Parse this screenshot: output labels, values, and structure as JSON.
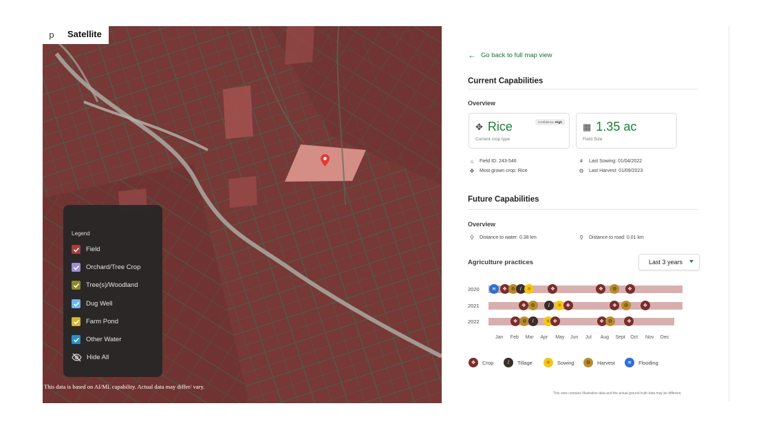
{
  "map": {
    "prev_tab": "p",
    "satellite_tab": "Satellite",
    "disclaimer": "This data is based on AI/ML capability. Actual data may differ/ vary.",
    "legend": {
      "title": "Legend",
      "items": [
        {
          "label": "Field",
          "color": "#b03a3a"
        },
        {
          "label": "Orchard/Tree Crop",
          "color": "#9b8fd6"
        },
        {
          "label": "Tree(s)/Woodland",
          "color": "#8a8a2a"
        },
        {
          "label": "Dug Well",
          "color": "#6fb5f0"
        },
        {
          "label": "Farm Pond",
          "color": "#d4b634"
        },
        {
          "label": "Other Water",
          "color": "#2a8fd0"
        }
      ],
      "hide_all": "Hide All"
    }
  },
  "panel": {
    "back_link": "Go back to full map view",
    "current": {
      "heading": "Current Capabilities",
      "overview": "Overview",
      "crop_value": "Rice",
      "crop_caption": "Current crop type",
      "confidence_label": "Confidence:",
      "confidence_value": "High",
      "size_value": "1.35 ac",
      "size_caption": "Field Size",
      "field_id": "Field ID: 243-546",
      "most_grown": "Most grown crop: Rice",
      "last_sowing": "Last Sowing: 01/04/2022",
      "last_harvest": "Last Harvest: 01/09/2023"
    },
    "future": {
      "heading": "Future Capabilities",
      "overview": "Overview",
      "dist_water": "Distance to water: 0.38 km",
      "dist_road": "Distance to road: 0.01 km"
    },
    "practices": {
      "heading": "Agriculture practices",
      "range_selected": "Last 3 years",
      "months": [
        "Jan",
        "Feb",
        "Mar",
        "Apr",
        "May",
        "Jun",
        "Jul",
        "Aug",
        "Sept",
        "Oct",
        "Nov",
        "Dec"
      ],
      "rows": [
        {
          "year": "2020",
          "events": [
            {
              "type": "flood",
              "month": 0.0
            },
            {
              "type": "crop",
              "month": 0.7
            },
            {
              "type": "harv",
              "month": 1.25
            },
            {
              "type": "till",
              "month": 1.75
            },
            {
              "type": "sow",
              "month": 2.3
            },
            {
              "type": "crop",
              "month": 3.85
            },
            {
              "type": "crop",
              "month": 7.0
            },
            {
              "type": "harv",
              "month": 7.9
            },
            {
              "type": "crop",
              "month": 8.9
            }
          ]
        },
        {
          "year": "2021",
          "events": [
            {
              "type": "crop",
              "month": 1.95
            },
            {
              "type": "harv",
              "month": 2.55
            },
            {
              "type": "till",
              "month": 3.6
            },
            {
              "type": "sow",
              "month": 4.3
            },
            {
              "type": "crop",
              "month": 4.85
            },
            {
              "type": "crop",
              "month": 7.9
            },
            {
              "type": "harv",
              "month": 8.65
            },
            {
              "type": "crop",
              "month": 9.9
            }
          ]
        },
        {
          "year": "2022",
          "events": [
            {
              "type": "crop",
              "month": 1.4
            },
            {
              "type": "harv",
              "month": 2.0
            },
            {
              "type": "till",
              "month": 2.55
            },
            {
              "type": "sow",
              "month": 3.55
            },
            {
              "type": "crop",
              "month": 4.0
            },
            {
              "type": "crop",
              "month": 7.05
            },
            {
              "type": "harv",
              "month": 7.6
            },
            {
              "type": "crop",
              "month": 8.85
            }
          ]
        }
      ],
      "legend": [
        {
          "type": "crop",
          "label": "Crop"
        },
        {
          "type": "till",
          "label": "Tillage"
        },
        {
          "type": "sow",
          "label": "Sowing"
        },
        {
          "type": "harv",
          "label": "Harvest"
        },
        {
          "type": "flood",
          "label": "Flooding"
        }
      ]
    },
    "footer_note": "This view contains Illustrative data and the actual ground truth data may be different."
  }
}
